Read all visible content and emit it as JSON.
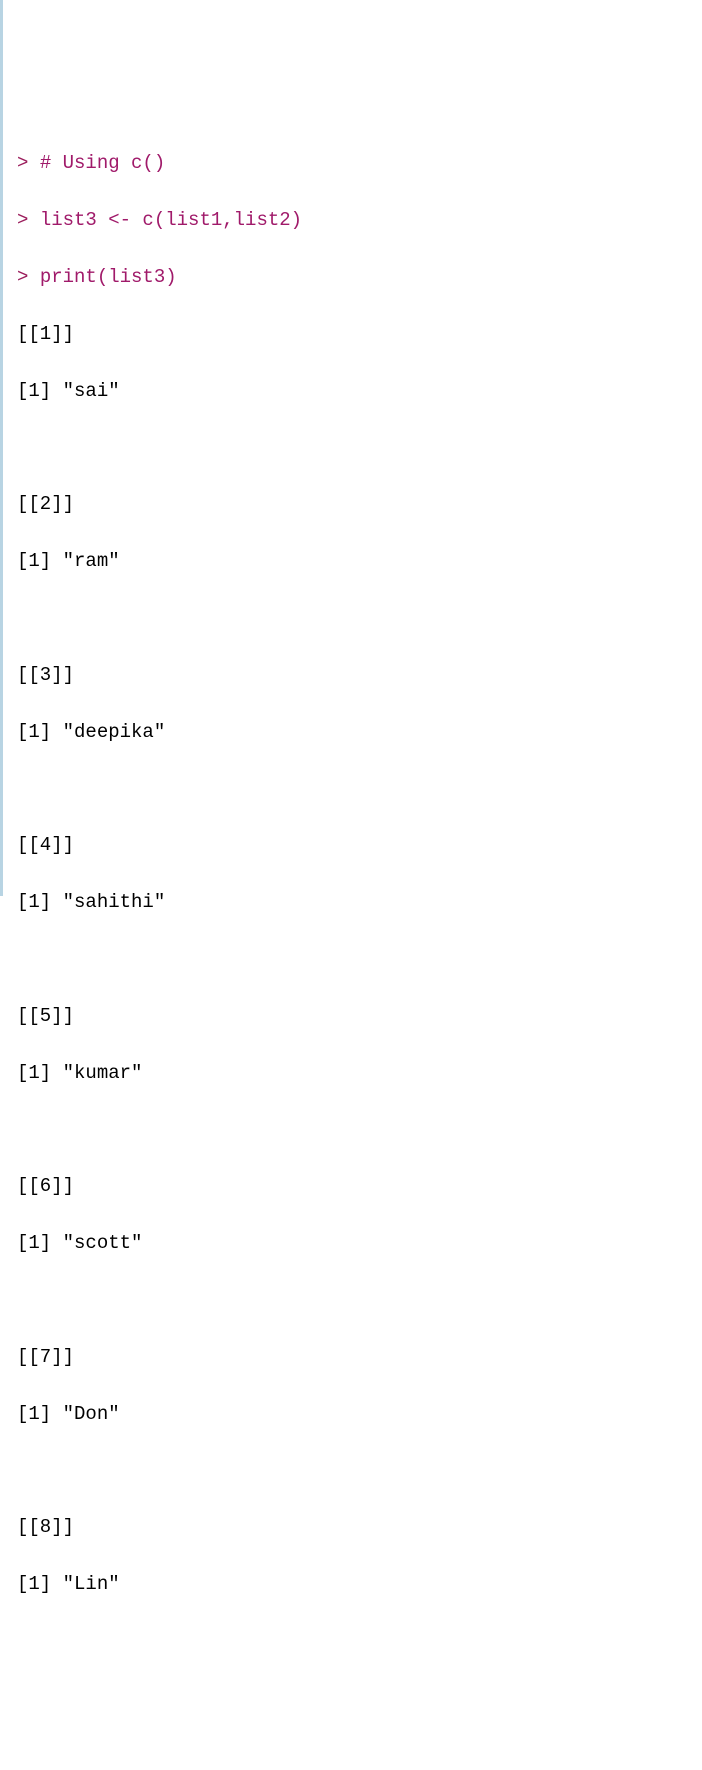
{
  "lines": {
    "l1_prompt": "> ",
    "l1_code": "# Using c()",
    "l2_prompt": "> ",
    "l2_code": "list3 <- c(list1,list2)",
    "l3_prompt": "> ",
    "l3_code": "print(list3)",
    "o1a": "[[1]]",
    "o1b": "[1] \"sai\"",
    "o2a": "[[2]]",
    "o2b": "[1] \"ram\"",
    "o3a": "[[3]]",
    "o3b": "[1] \"deepika\"",
    "o4a": "[[4]]",
    "o4b": "[1] \"sahithi\"",
    "o5a": "[[5]]",
    "o5b": "[1] \"kumar\"",
    "o6a": "[[6]]",
    "o6b": "[1] \"scott\"",
    "o7a": "[[7]]",
    "o7b": "[1] \"Don\"",
    "o8a": "[[8]]",
    "o8b": "[1] \"Lin\""
  }
}
